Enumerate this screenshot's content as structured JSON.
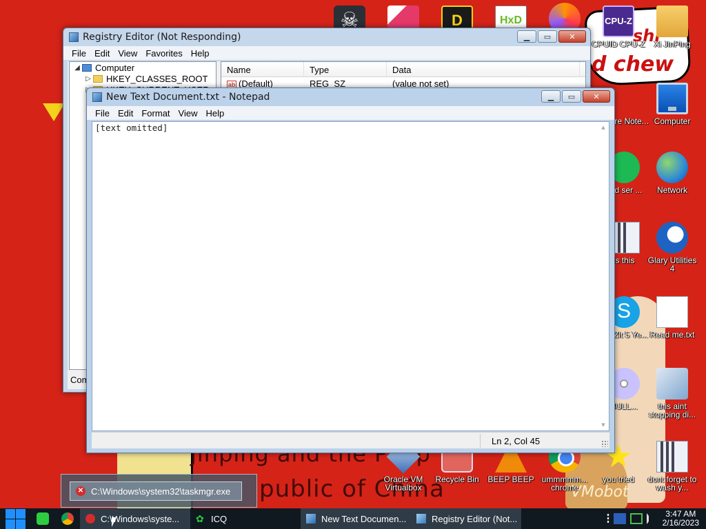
{
  "desktop": {
    "wallpaper_text": {
      "chew": "d chew",
      "shi": "shi",
      "jinping": "jinping and the Peop",
      "china": "public of China",
      "watermark": "VMobot"
    },
    "icons": [
      {
        "id": "skull",
        "label": ""
      },
      {
        "id": "pink",
        "label": ""
      },
      {
        "id": "dt",
        "label": ""
      },
      {
        "id": "hxd",
        "label": ""
      },
      {
        "id": "firefox",
        "label": ""
      },
      {
        "id": "cpuz",
        "label": "CPUID CPU-Z",
        "glyph_text": "CPU-Z"
      },
      {
        "id": "xiping",
        "label": "Xi JinPing"
      },
      {
        "id": "malware-note",
        "label": "eware Note..."
      },
      {
        "id": "computer",
        "label": "Computer"
      },
      {
        "id": "spotify",
        "label": "sed ser ..."
      },
      {
        "id": "network",
        "label": "Network"
      },
      {
        "id": "is-this",
        "label": "is this"
      },
      {
        "id": "glary",
        "label": "Glary Utilities 4"
      },
      {
        "id": "skype",
        "label": "hat Zit 5 Ye..."
      },
      {
        "id": "readme",
        "label": "Read me.txt"
      },
      {
        "id": "disc",
        "label": "BULL..."
      },
      {
        "id": "this-aint",
        "label": "this aint stopping di..."
      },
      {
        "id": "vbox",
        "label": "Oracle VM Virtualbox"
      },
      {
        "id": "recycle",
        "label": "Recycle Bin"
      },
      {
        "id": "vlc",
        "label": "BEEP BEEP"
      },
      {
        "id": "chrome",
        "label": "ummmmm... chrome"
      },
      {
        "id": "you-tried",
        "label": "you tried"
      },
      {
        "id": "wash",
        "label": "dont forget to wash y..."
      }
    ]
  },
  "regedit": {
    "title": "Registry Editor (Not Responding)",
    "menu": [
      "File",
      "Edit",
      "View",
      "Favorites",
      "Help"
    ],
    "tree": [
      {
        "label": "Computer",
        "arrow": "◢"
      },
      {
        "label": "HKEY_CLASSES_ROOT",
        "arrow": "▷"
      },
      {
        "label": "HKEY_CURRENT_USER",
        "arrow": "▷"
      }
    ],
    "columns": [
      "Name",
      "Type",
      "Data"
    ],
    "rows": [
      {
        "name": "(Default)",
        "type": "REG_SZ",
        "data": "(value not set)"
      }
    ],
    "status": "Com"
  },
  "notepad": {
    "title": "New Text Document.txt - Notepad",
    "menu": [
      "File",
      "Edit",
      "Format",
      "View",
      "Help"
    ],
    "content": "[text omitted]",
    "status_position": "Ln 2, Col 45"
  },
  "thumbnail": {
    "label": "C:\\Windows\\system32\\taskmgr.exe"
  },
  "taskbar": {
    "tasks": [
      {
        "id": "taskmgr",
        "label": "C:\\Windows\\syste..."
      },
      {
        "id": "icq",
        "label": "ICQ"
      },
      {
        "id": "notepad",
        "label": "New Text Documen..."
      },
      {
        "id": "regedit",
        "label": "Registry Editor (Not..."
      }
    ],
    "clock": {
      "time": "3:47 AM",
      "date": "2/16/2023"
    }
  },
  "colors": {
    "wallpaper": "#d52318",
    "taskbar": "#101820",
    "accent": "#1e90ff"
  }
}
